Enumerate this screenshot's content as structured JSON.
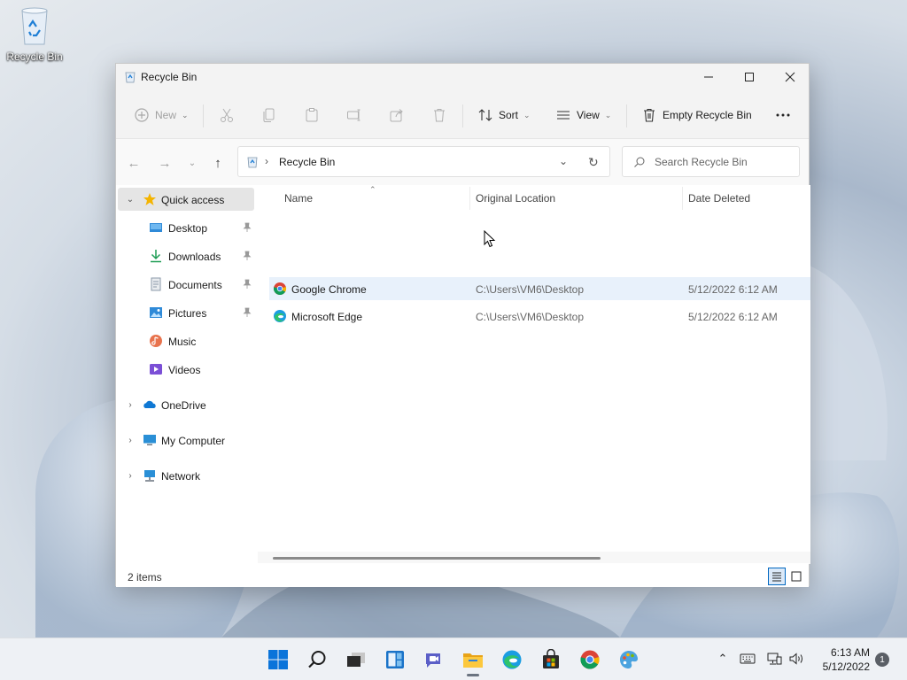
{
  "desktop": {
    "icons": [
      {
        "label": "Recycle Bin",
        "icon": "recycle-bin-icon"
      }
    ]
  },
  "window": {
    "title": "Recycle Bin",
    "controls": {
      "minimize": "minimize-icon",
      "maximize": "maximize-icon",
      "close": "close-icon"
    }
  },
  "toolbar": {
    "new_label": "New",
    "sort_label": "Sort",
    "view_label": "View",
    "empty_label": "Empty Recycle Bin",
    "more_icon": "more-icon",
    "disabled_icons": [
      "cut-icon",
      "copy-icon",
      "paste-icon",
      "rename-icon",
      "share-icon",
      "delete-icon"
    ]
  },
  "address": {
    "path": "Recycle Bin",
    "search_placeholder": "Search Recycle Bin"
  },
  "nav": {
    "quick_access": "Quick access",
    "items": [
      {
        "label": "Desktop",
        "icon": "desktop-folder-icon",
        "pinned": true
      },
      {
        "label": "Downloads",
        "icon": "downloads-icon",
        "pinned": true
      },
      {
        "label": "Documents",
        "icon": "documents-icon",
        "pinned": true
      },
      {
        "label": "Pictures",
        "icon": "pictures-icon",
        "pinned": true
      },
      {
        "label": "Music",
        "icon": "music-icon",
        "pinned": false
      },
      {
        "label": "Videos",
        "icon": "videos-icon",
        "pinned": false
      }
    ],
    "roots": [
      {
        "label": "OneDrive",
        "icon": "onedrive-icon"
      },
      {
        "label": "My Computer",
        "icon": "computer-icon"
      },
      {
        "label": "Network",
        "icon": "network-icon"
      }
    ]
  },
  "files": {
    "columns": [
      "Name",
      "Original Location",
      "Date Deleted"
    ],
    "rows": [
      {
        "name": "Google Chrome",
        "location": "C:\\Users\\VM6\\Desktop",
        "date": "5/12/2022 6:12 AM",
        "icon": "chrome-icon"
      },
      {
        "name": "Microsoft Edge",
        "location": "C:\\Users\\VM6\\Desktop",
        "date": "5/12/2022 6:12 AM",
        "icon": "edge-icon"
      }
    ]
  },
  "status": {
    "count_text": "2 items"
  },
  "taskbar": {
    "apps": [
      "start-icon",
      "search-icon",
      "task-view-icon",
      "widgets-icon",
      "chat-icon",
      "file-explorer-icon",
      "edge-icon",
      "store-icon",
      "chrome-icon",
      "paint-icon"
    ],
    "time": "6:13 AM",
    "date": "5/12/2022",
    "notifications": "1"
  },
  "colors": {
    "accent": "#0067c0",
    "selection": "#e5e5e5",
    "hover_row": "#e8f1fb"
  }
}
